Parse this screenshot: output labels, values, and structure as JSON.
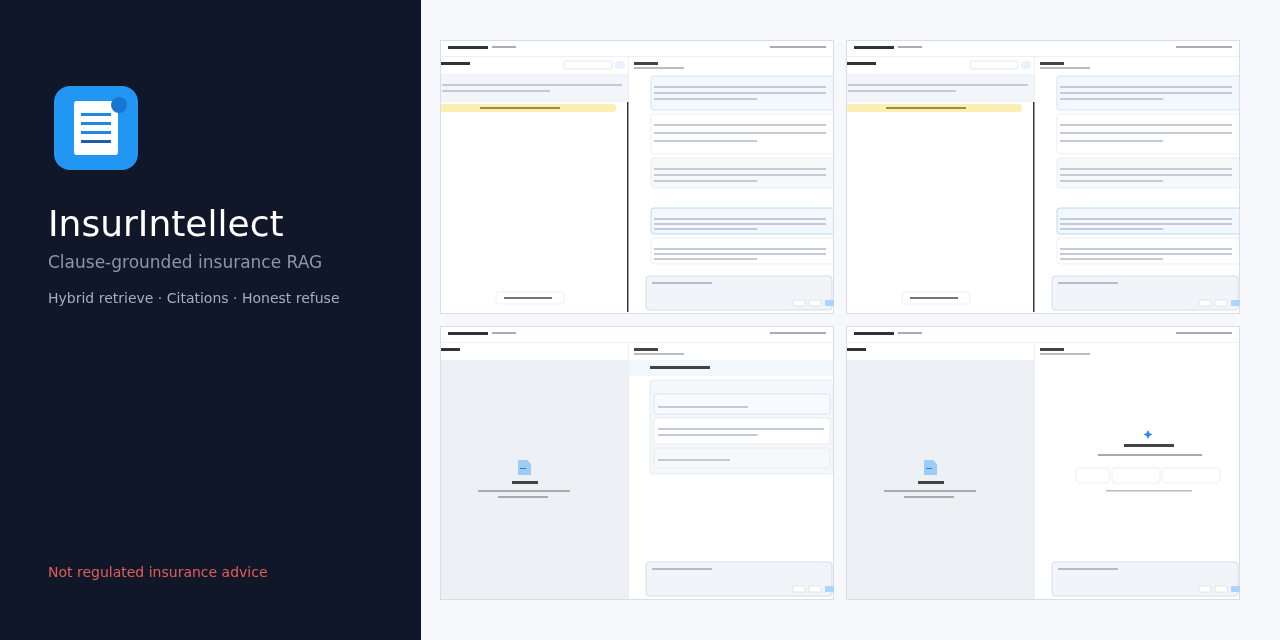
{
  "brand": {
    "name": "InsurIntellect",
    "tagline": "Clause-grounded insurance RAG",
    "features": "Hybrid retrieve · Citations · Honest refuse",
    "disclaimer": "Not regulated insurance advice"
  },
  "screenshots": [
    {
      "kind": "answer"
    },
    {
      "kind": "answer"
    },
    {
      "kind": "question"
    },
    {
      "kind": "welcome"
    }
  ]
}
